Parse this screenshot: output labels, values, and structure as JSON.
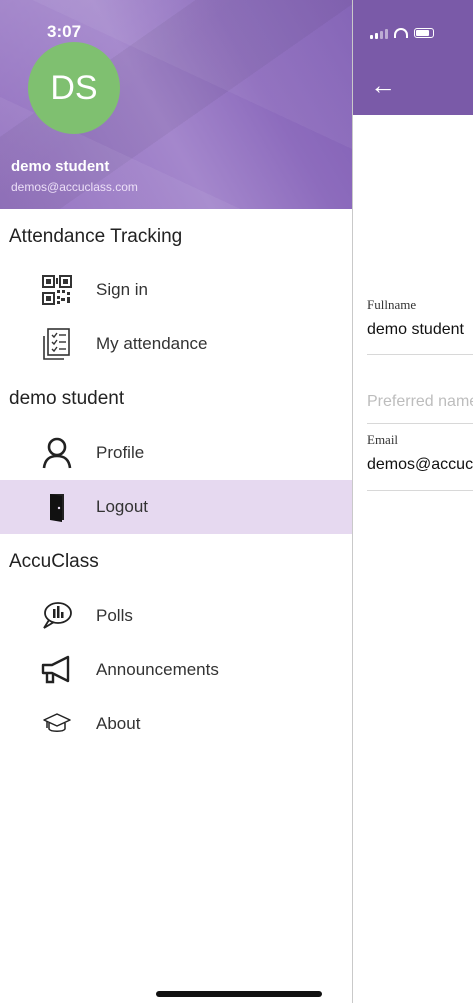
{
  "status_bar": {
    "time": "3:07"
  },
  "user": {
    "initials": "DS",
    "name": "demo student",
    "email": "demos@accuclass.com"
  },
  "drawer": {
    "sections": [
      {
        "title": "Attendance Tracking",
        "items": [
          {
            "label": "Sign in",
            "icon": "qr-code-icon"
          },
          {
            "label": "My attendance",
            "icon": "checklist-icon"
          }
        ]
      },
      {
        "title": "demo student",
        "items": [
          {
            "label": "Profile",
            "icon": "person-icon"
          },
          {
            "label": "Logout",
            "icon": "door-icon",
            "active": true
          }
        ]
      },
      {
        "title": "AccuClass",
        "items": [
          {
            "label": "Polls",
            "icon": "poll-chat-icon"
          },
          {
            "label": "Announcements",
            "icon": "megaphone-icon"
          },
          {
            "label": "About",
            "icon": "graduation-cap-icon"
          }
        ]
      }
    ]
  },
  "profile_form": {
    "fullname_label": "Fullname",
    "fullname_value": "demo student",
    "preferred_name_placeholder": "Preferred name",
    "email_label": "Email",
    "email_value": "demos@accuclass.com"
  },
  "colors": {
    "header_purple": "#7a5aa8",
    "avatar_green": "#7fc070",
    "active_item_bg": "#e6d9f0"
  }
}
